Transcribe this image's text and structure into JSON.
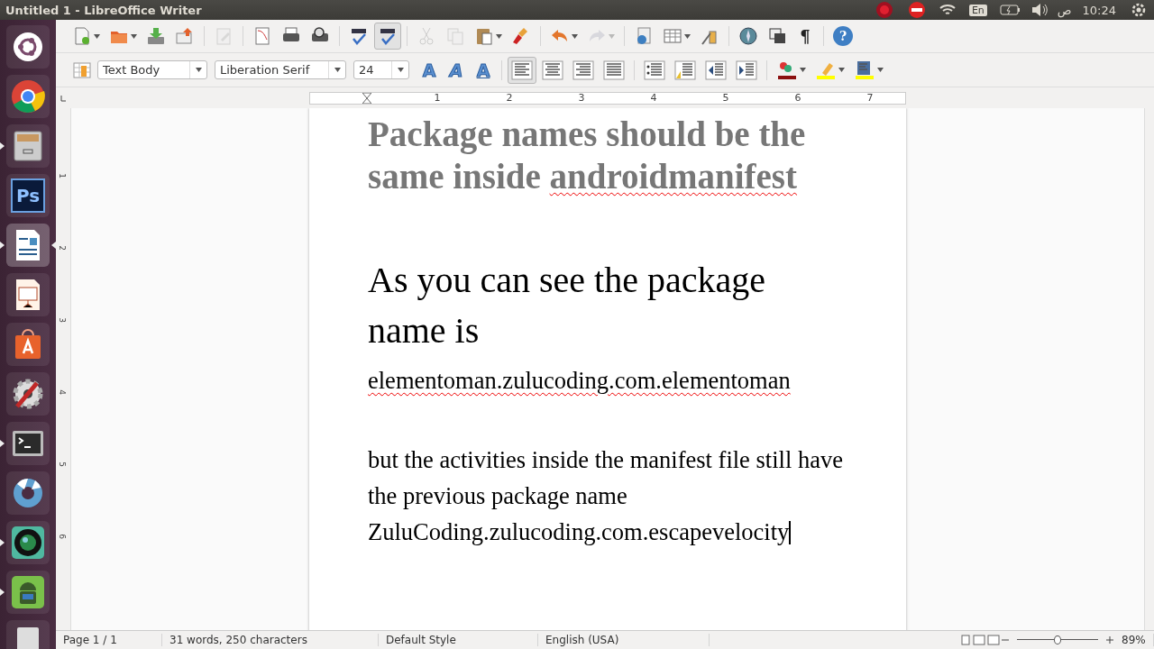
{
  "window": {
    "title": "Untitled 1 - LibreOffice Writer"
  },
  "panel": {
    "indicators": [
      {
        "kind": "record"
      },
      {
        "kind": "stop"
      },
      {
        "kind": "wifi"
      }
    ],
    "keyboard": "En",
    "period": "ص",
    "time": "10:24"
  },
  "launcher": [
    {
      "kind": "ubuntu",
      "running": false,
      "focused": false
    },
    {
      "kind": "chrome",
      "running": false,
      "focused": false
    },
    {
      "kind": "files",
      "running": true,
      "focused": false
    },
    {
      "kind": "ps",
      "label": "Ps",
      "running": false,
      "focused": false
    },
    {
      "kind": "writer",
      "running": true,
      "focused": true
    },
    {
      "kind": "impress",
      "running": false,
      "focused": false
    },
    {
      "kind": "store",
      "running": false,
      "focused": false
    },
    {
      "kind": "settings",
      "running": false,
      "focused": false
    },
    {
      "kind": "terminal",
      "running": true,
      "focused": false
    },
    {
      "kind": "shutter",
      "running": false,
      "focused": false
    },
    {
      "kind": "camera",
      "running": true,
      "focused": false
    },
    {
      "kind": "android",
      "running": true,
      "focused": false
    },
    {
      "kind": "drive",
      "running": false,
      "focused": false
    }
  ],
  "toolbar": [
    {
      "kind": "new",
      "dropdown": true,
      "disabled": false,
      "selected": false
    },
    {
      "kind": "open",
      "dropdown": true,
      "disabled": false,
      "selected": false
    },
    {
      "kind": "save",
      "dropdown": false,
      "disabled": false,
      "selected": false
    },
    {
      "kind": "mail",
      "dropdown": false,
      "disabled": false,
      "selected": false
    },
    {
      "kind": "sep"
    },
    {
      "kind": "edit",
      "dropdown": false,
      "disabled": true,
      "selected": false
    },
    {
      "kind": "sep"
    },
    {
      "kind": "pdf",
      "dropdown": false,
      "disabled": false,
      "selected": false
    },
    {
      "kind": "print",
      "dropdown": false,
      "disabled": false,
      "selected": false
    },
    {
      "kind": "preview",
      "dropdown": false,
      "disabled": false,
      "selected": false
    },
    {
      "kind": "sep"
    },
    {
      "kind": "spell",
      "dropdown": false,
      "disabled": false,
      "selected": false
    },
    {
      "kind": "spell",
      "dropdown": false,
      "disabled": false,
      "selected": true
    },
    {
      "kind": "sep"
    },
    {
      "kind": "cut",
      "dropdown": false,
      "disabled": true,
      "selected": false
    },
    {
      "kind": "copy",
      "dropdown": false,
      "disabled": true,
      "selected": false
    },
    {
      "kind": "paste",
      "dropdown": true,
      "disabled": false,
      "selected": false
    },
    {
      "kind": "brush",
      "dropdown": false,
      "disabled": false,
      "selected": false
    },
    {
      "kind": "sep"
    },
    {
      "kind": "undo",
      "dropdown": true,
      "disabled": false,
      "selected": false
    },
    {
      "kind": "redo",
      "dropdown": true,
      "disabled": true,
      "selected": false
    },
    {
      "kind": "sep"
    },
    {
      "kind": "hyperlink",
      "dropdown": false,
      "disabled": false,
      "selected": false
    },
    {
      "kind": "table",
      "dropdown": true,
      "disabled": false,
      "selected": false
    },
    {
      "kind": "draw",
      "dropdown": false,
      "disabled": false,
      "selected": false
    },
    {
      "kind": "sep"
    },
    {
      "kind": "navigator",
      "dropdown": false,
      "disabled": false,
      "selected": false
    },
    {
      "kind": "windows",
      "dropdown": false,
      "disabled": false,
      "selected": false
    },
    {
      "kind": "pilcrow",
      "label": "¶",
      "dropdown": false,
      "disabled": false,
      "selected": false
    },
    {
      "kind": "sep"
    },
    {
      "kind": "help",
      "label": "?",
      "dropdown": false,
      "disabled": false,
      "selected": false
    }
  ],
  "format_bar": {
    "paragraph_style": "Text Body",
    "font": "Liberation Serif",
    "size": "24",
    "buttons": [
      {
        "kind": "bold",
        "label": "A",
        "selected": false
      },
      {
        "kind": "italic",
        "label": "A",
        "selected": false
      },
      {
        "kind": "underline",
        "label": "A",
        "selected": false
      },
      {
        "kind": "sep"
      },
      {
        "kind": "align-left",
        "selected": true
      },
      {
        "kind": "align-center",
        "selected": false
      },
      {
        "kind": "align-right",
        "selected": false
      },
      {
        "kind": "justify",
        "selected": false
      },
      {
        "kind": "sep"
      },
      {
        "kind": "bullets",
        "selected": false
      },
      {
        "kind": "numbering",
        "selected": false
      },
      {
        "kind": "outdent",
        "selected": false
      },
      {
        "kind": "indent",
        "selected": false
      },
      {
        "kind": "sep"
      },
      {
        "kind": "font-color",
        "selected": false
      },
      {
        "kind": "highlight",
        "selected": false
      },
      {
        "kind": "background",
        "selected": false
      }
    ]
  },
  "ruler": {
    "numbers": [
      "1",
      "2",
      "3",
      "4",
      "5",
      "6",
      "7"
    ]
  },
  "vertical_ruler": {
    "numbers": [
      "1",
      "2",
      "3",
      "4",
      "5",
      "6"
    ]
  },
  "document": {
    "paragraphs": [
      {
        "kind": "heading",
        "runs": [
          {
            "text": "Package names should be the same inside ",
            "misspelled": false
          },
          {
            "text": "androidmanifest",
            "misspelled": true
          }
        ]
      },
      {
        "kind": "blank"
      },
      {
        "kind": "large",
        "runs": [
          {
            "text": "As you can see the package name is",
            "misspelled": false
          }
        ]
      },
      {
        "kind": "body",
        "runs": [
          {
            "text": "elementoman.zulucoding.com.elementoman",
            "misspelled": true
          }
        ]
      },
      {
        "kind": "blank"
      },
      {
        "kind": "body",
        "runs": [
          {
            "text": "but the activities inside the manifest file still have the previous package name",
            "misspelled": false
          }
        ]
      },
      {
        "kind": "body",
        "cursor": true,
        "runs": [
          {
            "text": "ZuluCoding.zulucoding.com.escapevelocity",
            "misspelled": false
          }
        ]
      }
    ]
  },
  "status_bar": {
    "page": "Page 1 / 1",
    "words": "31 words, 250 characters",
    "style": "Default Style",
    "language": "English (USA)",
    "zoom": "89%",
    "zoom_slider": {
      "level": 0.5
    }
  }
}
